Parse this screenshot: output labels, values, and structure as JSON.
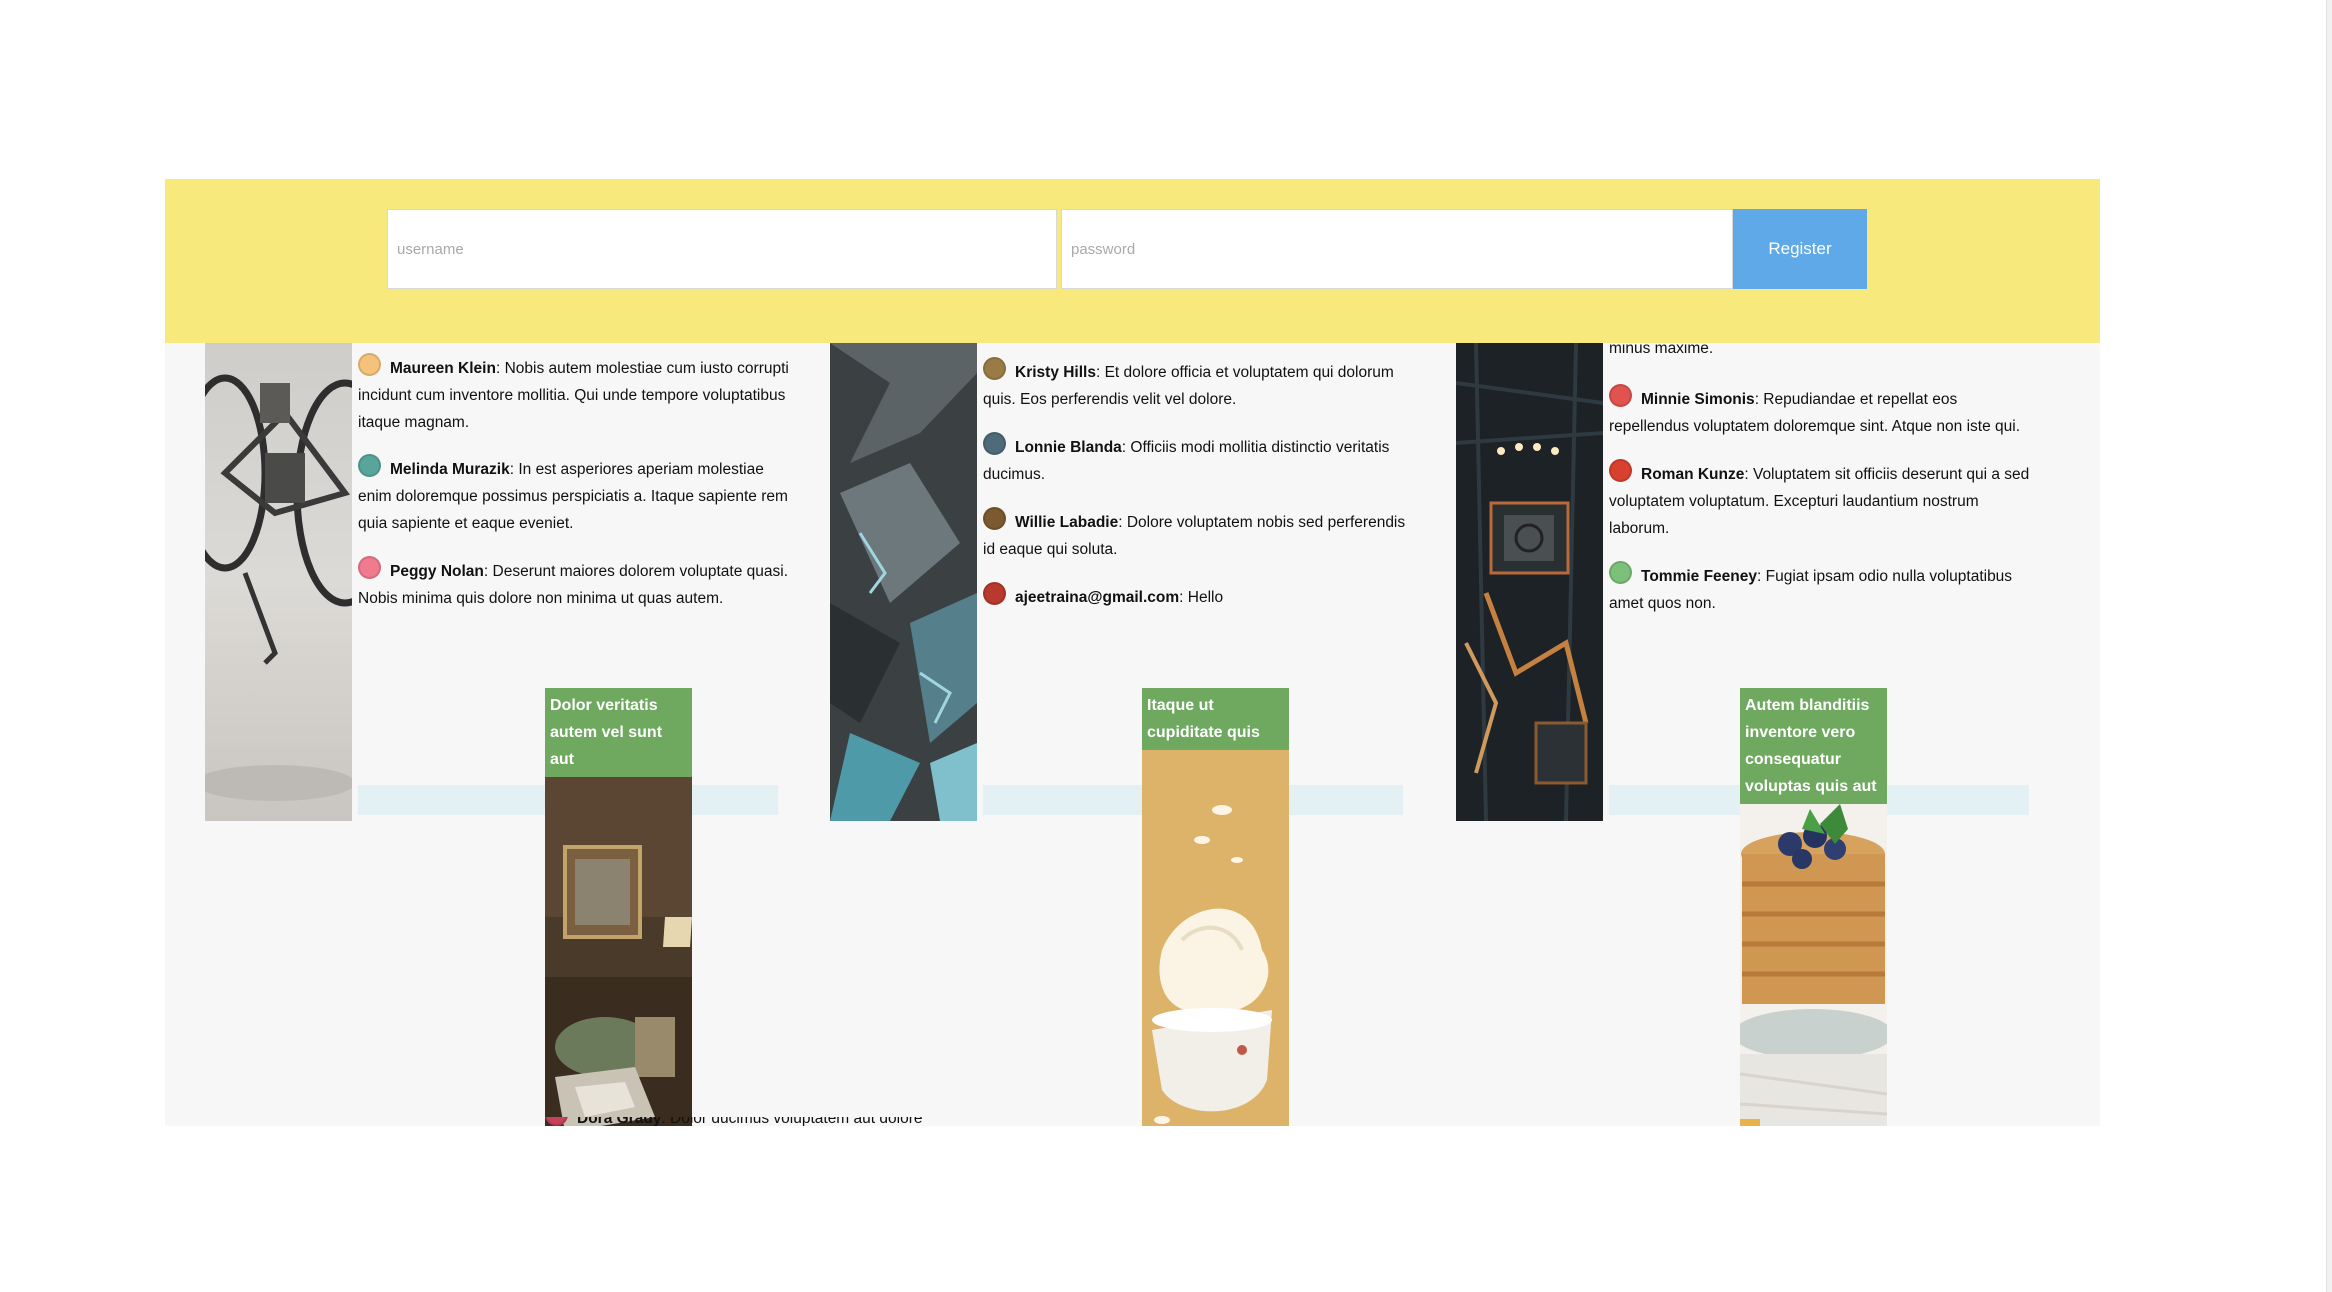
{
  "form": {
    "username_placeholder": "username",
    "password_placeholder": "password",
    "register_label": "Register"
  },
  "cards": [
    {
      "comments": [
        {
          "author": "Maureen Klein",
          "text": ": Nobis autem molestiae cum iusto corrupti incidunt cum inventore mollitia. Qui unde tempore voluptatibus itaque magnam.",
          "avatar_color": "#f4c27a"
        },
        {
          "author": "Melinda Murazik",
          "text": ": In est asperiores aperiam molestiae enim doloremque possimus perspiciatis a. Itaque sapiente rem quia sapiente et eaque eveniet.",
          "avatar_color": "#5aa59b"
        },
        {
          "author": "Peggy Nolan",
          "text": ": Deserunt maiores dolorem voluptate quasi. Nobis minima quis dolore non minima ut quas autem.",
          "avatar_color": "#f07a8e"
        }
      ]
    },
    {
      "comments": [
        {
          "author": "Kristy Hills",
          "text": ": Et dolore officia et voluptatem qui dolorum quis. Eos perferendis velit vel dolore.",
          "avatar_color": "#9b7b45"
        },
        {
          "author": "Lonnie Blanda",
          "text": ": Officiis modi mollitia distinctio veritatis ducimus.",
          "avatar_color": "#4f6a78"
        },
        {
          "author": "Willie Labadie",
          "text": ": Dolore voluptatem nobis sed perferendis id eaque qui soluta.",
          "avatar_color": "#7a5a2e"
        },
        {
          "author": "ajeetraina@gmail.com",
          "text": ": Hello",
          "avatar_color": "#b83a2e"
        }
      ]
    },
    {
      "top_fragment": "minus maxime.",
      "comments": [
        {
          "author": "Minnie Simonis",
          "text": ": Repudiandae et repellat eos repellendus voluptatem doloremque sint. Atque non iste qui.",
          "avatar_color": "#e0534f"
        },
        {
          "author": "Roman Kunze",
          "text": ": Voluptatem sit officiis deserunt qui a sed voluptatem voluptatum. Excepturi laudantium nostrum laborum.",
          "avatar_color": "#d9412f"
        },
        {
          "author": "Tommie Feeney",
          "text": ": Fugiat ipsam odio nulla voluptatibus amet quos non.",
          "avatar_color": "#7cc07a"
        }
      ]
    }
  ],
  "posts": [
    {
      "title": "Dolor veritatis autem vel sunt aut",
      "peek_author": "Dora Grady",
      "peek_text": ": Dolor ducimus voluptatem aut dolore"
    },
    {
      "title": "Itaque ut cupiditate quis"
    },
    {
      "title": "Autem blanditiis inventore vero consequatur voluptas quis aut"
    }
  ]
}
